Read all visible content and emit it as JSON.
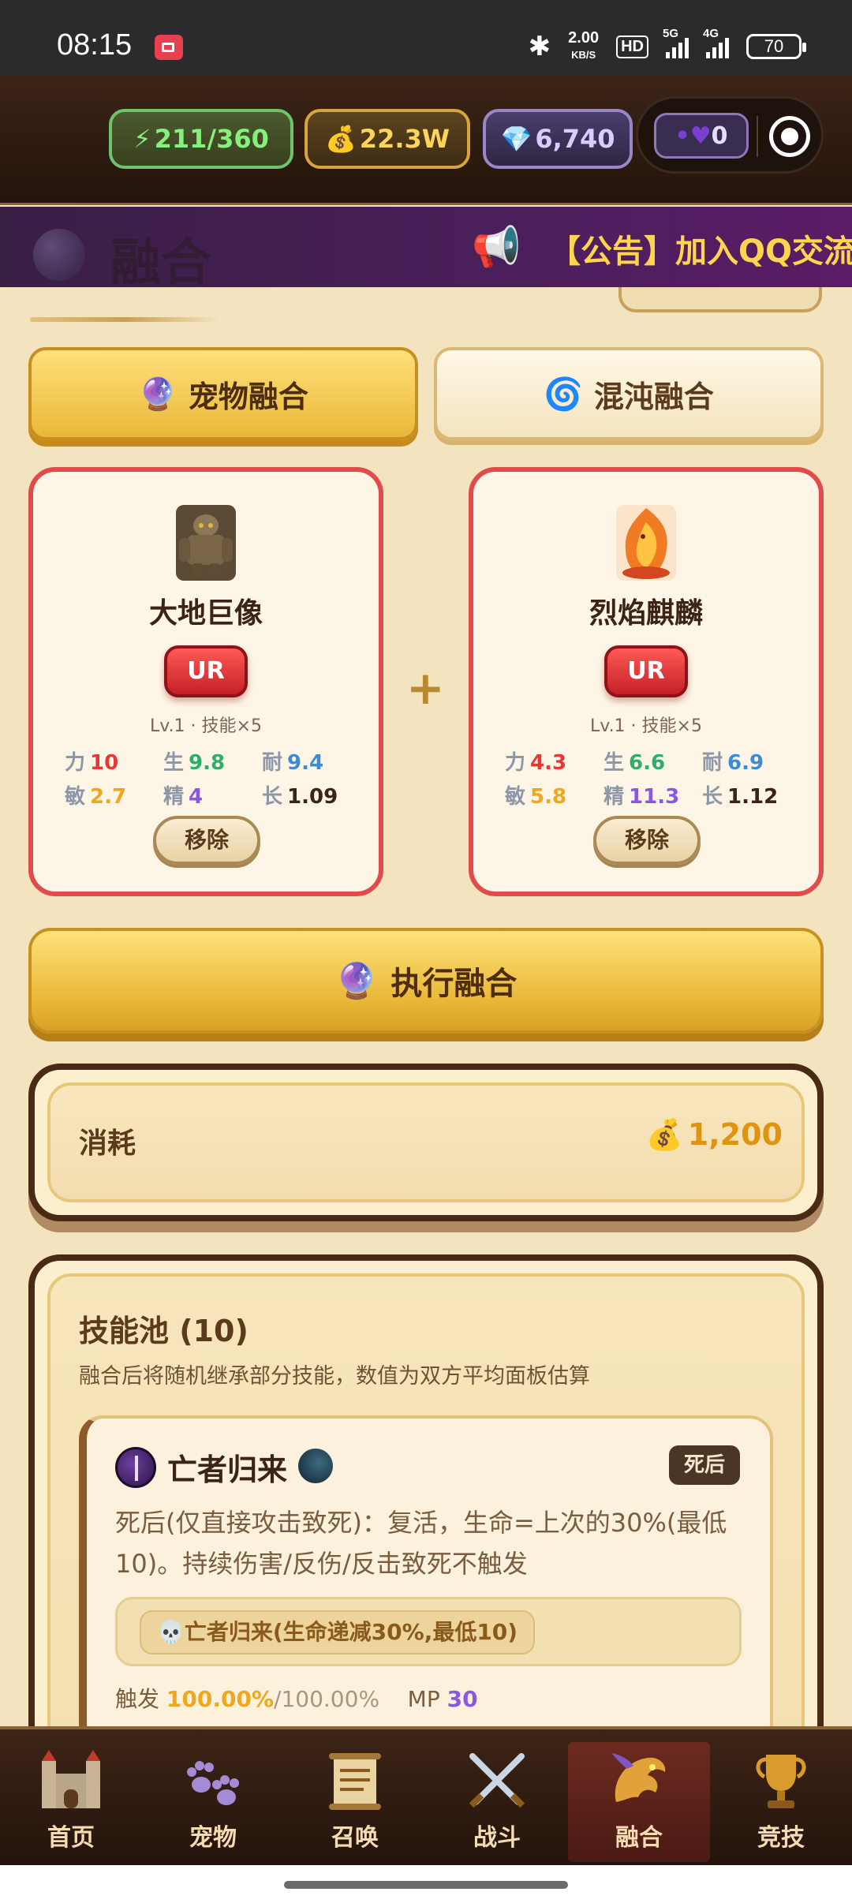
{
  "status_bar": {
    "time": "08:15",
    "net_speed_value": "2.00",
    "net_speed_unit": "KB/S",
    "hd_label": "HD",
    "signal1_label": "5G",
    "signal2_label": "4G",
    "battery": "70"
  },
  "resources": {
    "energy": "211/360",
    "gold": "22.3W",
    "gems": "6,740",
    "hearts": "0",
    "energy_icon": "lightning-icon",
    "gold_icon": "money-bag-icon",
    "gem_icon": "diamond-icon"
  },
  "announcement": {
    "page_title_ghost": "融合",
    "text": "【公告】加入QQ交流"
  },
  "tabs": [
    {
      "label": "宠物融合",
      "icon": "crystal-ball-icon",
      "active": true
    },
    {
      "label": "混沌融合",
      "icon": "cyclone-icon",
      "active": false
    }
  ],
  "pets": [
    {
      "name": "大地巨像",
      "rarity": "UR",
      "level_info": "Lv.1 · 技能×5",
      "stats": [
        {
          "k": "力",
          "v": "10"
        },
        {
          "k": "生",
          "v": "9.8"
        },
        {
          "k": "耐",
          "v": "9.4"
        },
        {
          "k": "敏",
          "v": "2.7"
        },
        {
          "k": "精",
          "v": "4"
        },
        {
          "k": "长",
          "v": "1.09"
        }
      ],
      "remove_label": "移除"
    },
    {
      "name": "烈焰麒麟",
      "rarity": "UR",
      "level_info": "Lv.1 · 技能×5",
      "stats": [
        {
          "k": "力",
          "v": "4.3"
        },
        {
          "k": "生",
          "v": "6.6"
        },
        {
          "k": "耐",
          "v": "6.9"
        },
        {
          "k": "敏",
          "v": "5.8"
        },
        {
          "k": "精",
          "v": "11.3"
        },
        {
          "k": "长",
          "v": "1.12"
        }
      ],
      "remove_label": "移除"
    }
  ],
  "plus": "+",
  "execute_label": "执行融合",
  "cost": {
    "label": "消耗",
    "value": "1,200"
  },
  "skill_pool": {
    "title": "技能池 (10)",
    "subtitle": "融合后将随机继承部分技能，数值为双方平均面板估算",
    "skill": {
      "name": "亡者归来",
      "tag": "死后",
      "description": "死后(仅直接攻击致死)：复活，生命=上次的30%(最低10)。持续伤害/反伤/反击致死不触发",
      "effect": "亡者归来(生命递减30%,最低10)",
      "trigger_label": "触发",
      "trigger_pct": "100.00%",
      "trigger_max": "/100.00%",
      "mp_label": "MP",
      "mp_value": "30"
    }
  },
  "nav": [
    {
      "label": "首页",
      "icon": "castle-icon"
    },
    {
      "label": "宠物",
      "icon": "paw-icon"
    },
    {
      "label": "召唤",
      "icon": "scroll-icon"
    },
    {
      "label": "战斗",
      "icon": "crossed-swords-icon"
    },
    {
      "label": "融合",
      "icon": "dragon-icon",
      "active": true
    },
    {
      "label": "竞技",
      "icon": "trophy-icon"
    }
  ],
  "colors": {
    "accent_gold": "#e9b83a",
    "card_border_red": "#e04b4b",
    "header_dark": "#2b190f",
    "background": "#f3e3bf"
  }
}
